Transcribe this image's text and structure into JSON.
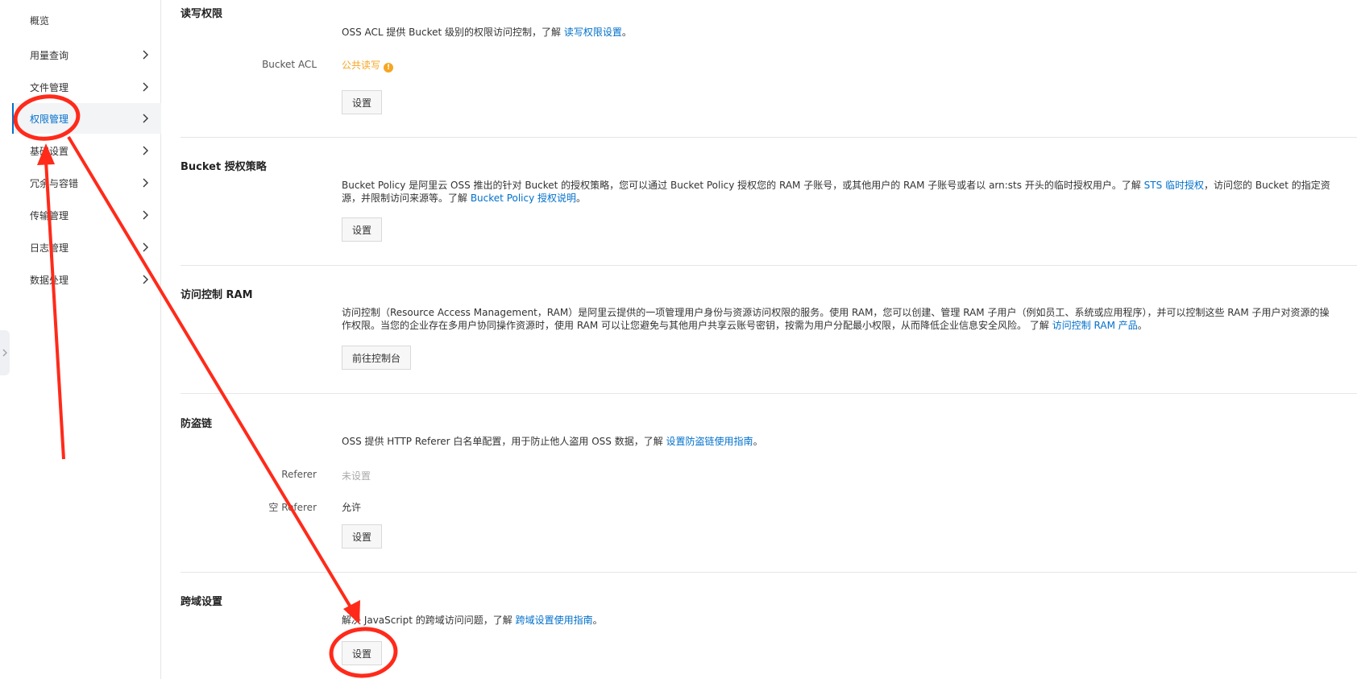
{
  "sidebar": {
    "items": [
      {
        "label": "概览",
        "has_chevron": false,
        "active": false
      },
      {
        "label": "用量查询",
        "has_chevron": true,
        "active": false
      },
      {
        "label": "文件管理",
        "has_chevron": true,
        "active": false
      },
      {
        "label": "权限管理",
        "has_chevron": true,
        "active": true
      },
      {
        "label": "基础设置",
        "has_chevron": true,
        "active": false
      },
      {
        "label": "冗余与容错",
        "has_chevron": true,
        "active": false
      },
      {
        "label": "传输管理",
        "has_chevron": true,
        "active": false
      },
      {
        "label": "日志管理",
        "has_chevron": true,
        "active": false
      },
      {
        "label": "数据处理",
        "has_chevron": true,
        "active": false
      }
    ]
  },
  "sections": {
    "rw": {
      "title": "读写权限",
      "desc_text": "OSS ACL 提供 Bucket 级别的权限访问控制，了解 ",
      "desc_link": "读写权限设置",
      "desc_end": "。",
      "acl_label": "Bucket ACL",
      "acl_value": "公共读写",
      "acl_value_color": "#f5a623",
      "button": "设置"
    },
    "policy": {
      "title": "Bucket 授权策略",
      "desc_part1": "Bucket Policy 是阿里云 OSS 推出的针对 Bucket 的授权策略，您可以通过 Bucket Policy 授权您的 RAM 子账号，或其他用户的 RAM 子账号或者以 arn:sts 开头的临时授权用户。了解 ",
      "desc_link1": "STS 临时授权",
      "desc_part2": "，访问您的 Bucket 的指定资源，并限制访问来源等。了解 ",
      "desc_link2": "Bucket Policy 授权说明",
      "desc_end": "。",
      "button": "设置"
    },
    "ram": {
      "title": "访问控制 RAM",
      "desc_part1": "访问控制（Resource Access Management，RAM）是阿里云提供的一项管理用户身份与资源访问权限的服务。使用 RAM，您可以创建、管理 RAM 子用户（例如员工、系统或应用程序），并可以控制这些 RAM 子用户对资源的操作权限。当您的企业存在多用户协同操作资源时，使用 RAM 可以让您避免与其他用户共享云账号密钥，按需为用户分配最小权限，从而降低企业信息安全风险。 了解 ",
      "desc_link": "访问控制 RAM 产品",
      "desc_end": "。",
      "button": "前往控制台"
    },
    "referer": {
      "title": "防盗链",
      "desc_text": "OSS 提供 HTTP Referer 白名单配置，用于防止他人盗用 OSS 数据，了解 ",
      "desc_link": "设置防盗链使用指南",
      "desc_end": "。",
      "referer_label": "Referer",
      "referer_value": "未设置",
      "empty_label": "空 Referer",
      "empty_value": "允许",
      "button": "设置"
    },
    "cors": {
      "title": "跨域设置",
      "desc_text": "解决 JavaScript 的跨域访问问题，了解 ",
      "desc_link": "跨域设置使用指南",
      "desc_end": "。",
      "button": "设置"
    }
  },
  "colors": {
    "link": "#0070cc",
    "annotation": "#ff2a1a",
    "warning": "#f5a623"
  }
}
